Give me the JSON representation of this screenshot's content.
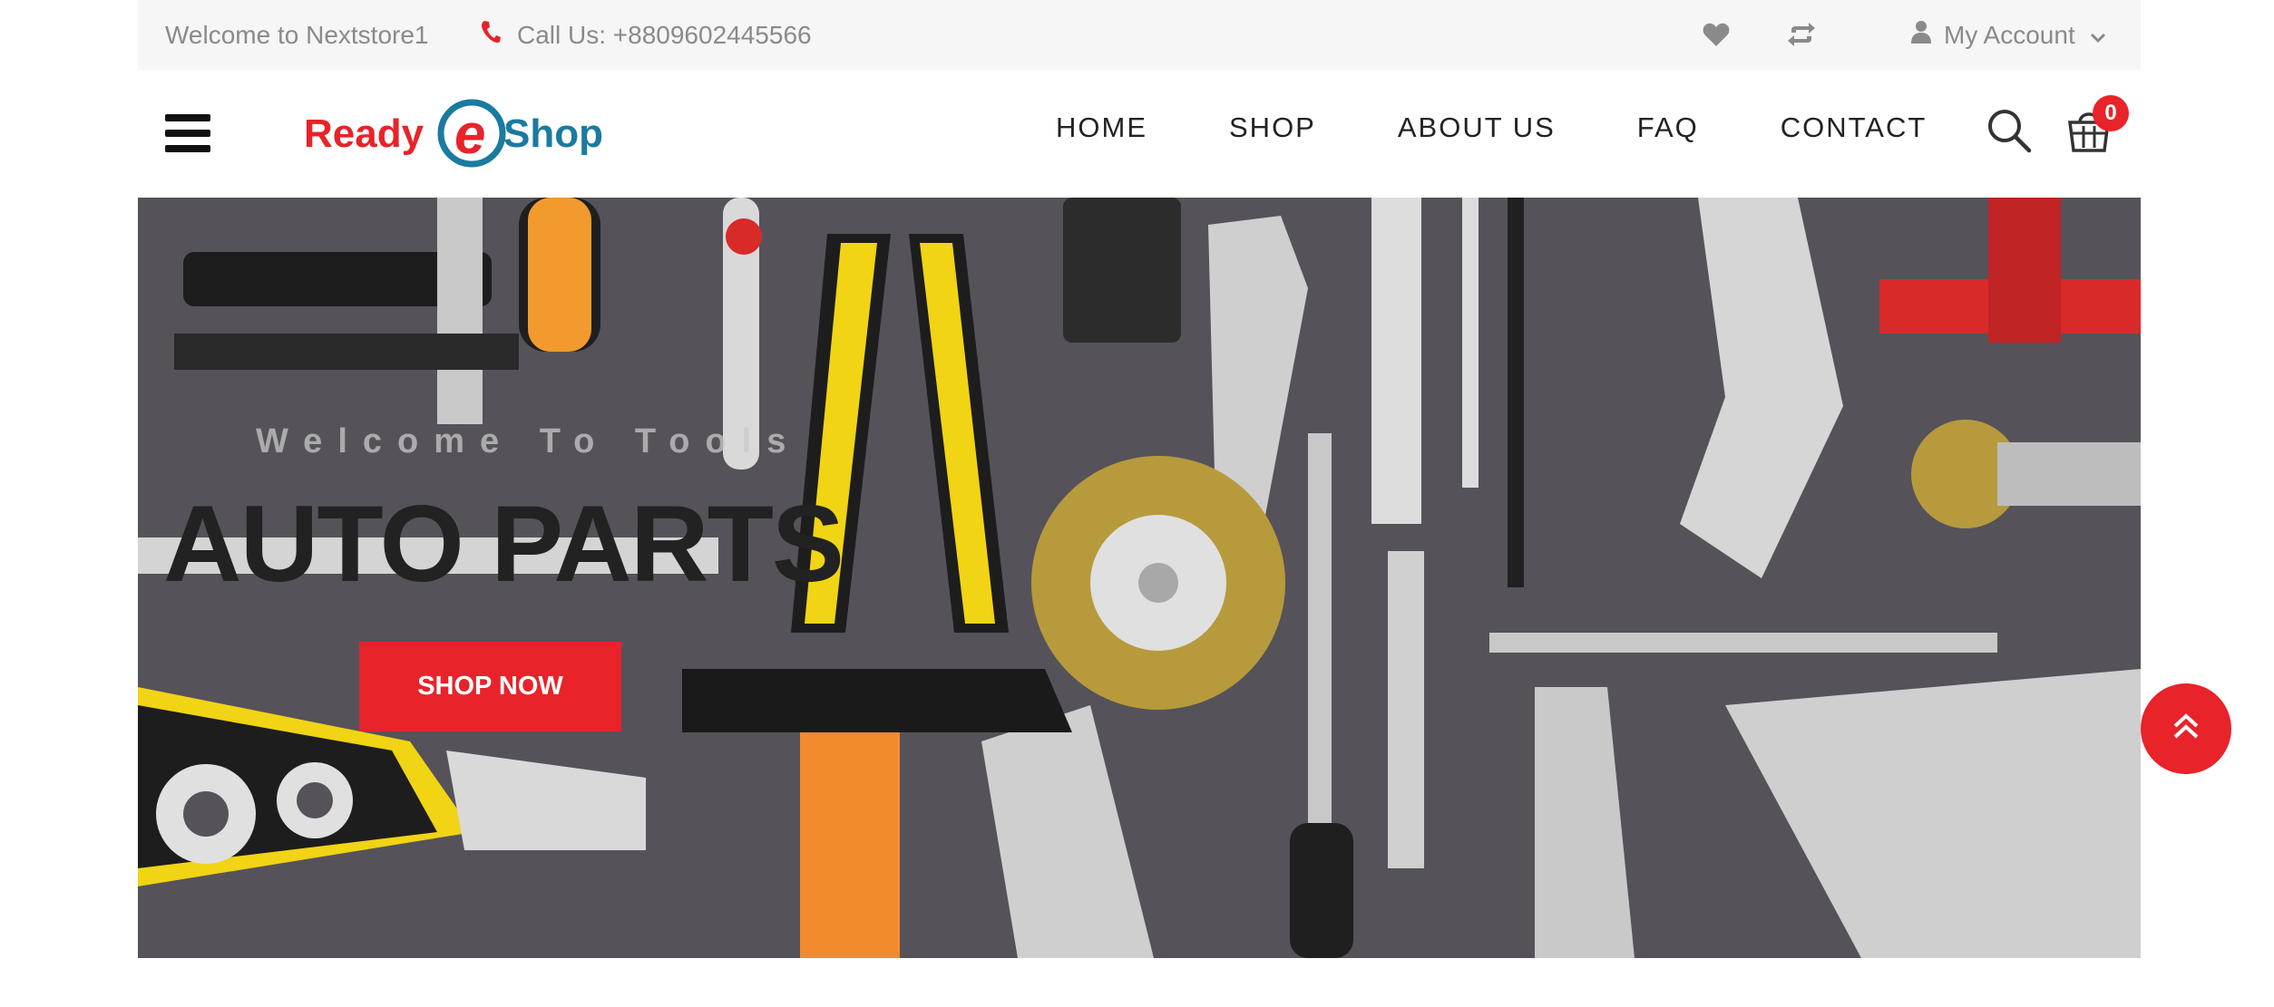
{
  "topbar": {
    "welcome": "Welcome to Nextstore1",
    "call": "Call Us: +8809602445566",
    "account_label": "My Account",
    "icons": [
      "phone-icon",
      "heart-icon",
      "compare-icon",
      "user-icon",
      "chevron-down-icon"
    ]
  },
  "header": {
    "logo_text_left": "Ready",
    "logo_text_mid": "e",
    "logo_text_right": "Shop",
    "nav": [
      {
        "label": "HOME"
      },
      {
        "label": "SHOP"
      },
      {
        "label": "ABOUT US"
      },
      {
        "label": "FAQ"
      },
      {
        "label": "CONTACT"
      }
    ],
    "cart_count": "0",
    "icons": [
      "hamburger-icon",
      "search-icon",
      "cart-icon"
    ]
  },
  "hero": {
    "subtitle": "Welcome To Tools",
    "title": "AUTO PARTS",
    "cta": "SHOP NOW"
  },
  "colors": {
    "accent": "#e8232a",
    "logo_red": "#e8232a",
    "logo_blue": "#1a7aa0",
    "topbar_bg": "#f6f6f6",
    "hero_bg": "#56525a"
  }
}
